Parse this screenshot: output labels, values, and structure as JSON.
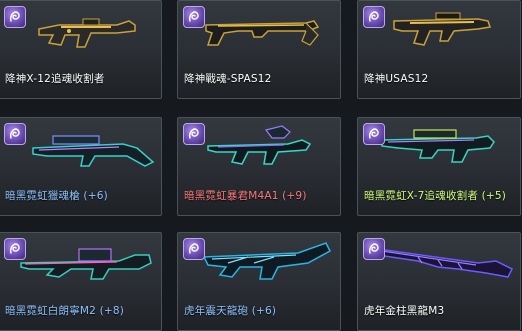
{
  "colors": {
    "label_white": "#ffffff",
    "label_blue": "#8fc3ff",
    "label_red": "#ff7b7b",
    "label_green": "#d2ff7a",
    "badge": "#7a5cc4"
  },
  "items": [
    {
      "name": "降神X-12追魂收割者",
      "label_color": "#ffffff",
      "badge_icon": "spiral-emblem-icon",
      "weapon_icon": "gold-rifle-icon"
    },
    {
      "name": "降神戰魂-SPAS12",
      "label_color": "#ffffff",
      "badge_icon": "spiral-emblem-icon",
      "weapon_icon": "gold-shotgun-icon"
    },
    {
      "name": "降神USAS12",
      "label_color": "#ffffff",
      "badge_icon": "spiral-emblem-icon",
      "weapon_icon": "gold-auto-shotgun-icon"
    },
    {
      "name": "暗黑霓虹獵魂槍 (+6)",
      "label_color": "#8fc3ff",
      "badge_icon": "spiral-emblem-icon",
      "weapon_icon": "neon-sniper-icon"
    },
    {
      "name": "暗黑霓虹暴君M4A1 (+9)",
      "label_color": "#ff7b7b",
      "badge_icon": "spiral-emblem-icon",
      "weapon_icon": "neon-assault-rifle-icon"
    },
    {
      "name": "暗黑霓虹X-7追魂收割者 (+5)",
      "label_color": "#d2ff7a",
      "badge_icon": "spiral-emblem-icon",
      "weapon_icon": "neon-machine-gun-icon"
    },
    {
      "name": "暗黑霓虹白朗寧M2 (+8)",
      "label_color": "#8fc3ff",
      "badge_icon": "spiral-emblem-icon",
      "weapon_icon": "neon-heavy-mg-icon"
    },
    {
      "name": "虎年震天龍砲 (+6)",
      "label_color": "#8fc3ff",
      "badge_icon": "spiral-emblem-icon",
      "weapon_icon": "tiger-cannon-icon"
    },
    {
      "name": "虎年金柱黑龍M3",
      "label_color": "#ffffff",
      "badge_icon": "spiral-emblem-icon",
      "weapon_icon": "tiger-shotgun-icon"
    }
  ]
}
